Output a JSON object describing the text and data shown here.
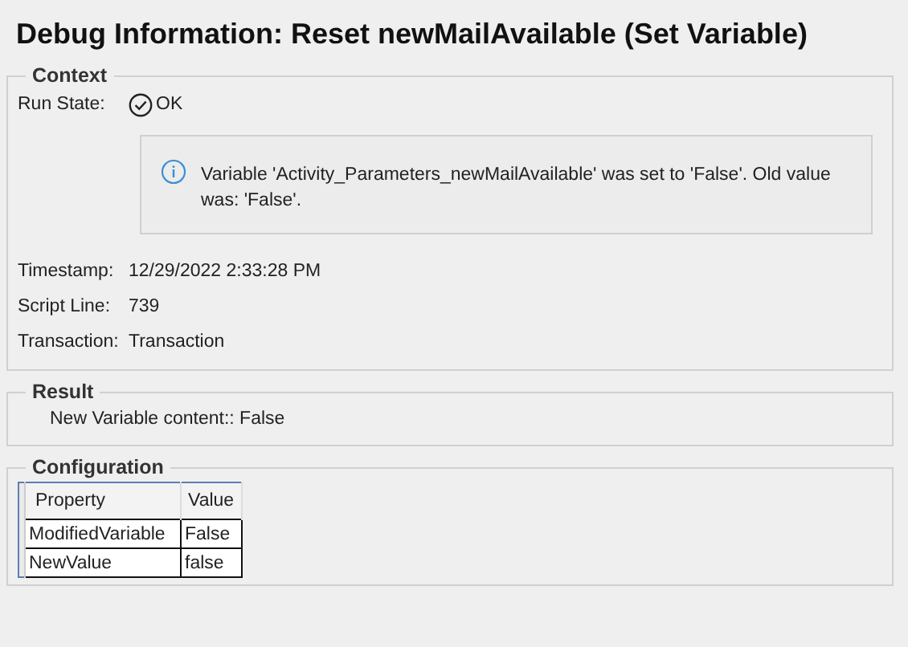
{
  "title": "Debug Information: Reset newMailAvailable (Set Variable)",
  "context": {
    "legend": "Context",
    "run_state": {
      "label": "Run State:",
      "value": "OK"
    },
    "message": "Variable 'Activity_Parameters_newMailAvailable' was set to 'False'. Old value was: 'False'.",
    "fields": [
      {
        "label": "Timestamp:",
        "value": "12/29/2022 2:33:28 PM"
      },
      {
        "label": "Script Line:",
        "value": "739"
      },
      {
        "label": "Transaction:",
        "value": "Transaction"
      }
    ]
  },
  "result": {
    "legend": "Result",
    "text": "New Variable content:: False"
  },
  "configuration": {
    "legend": "Configuration",
    "columns": [
      "Property",
      "Value"
    ],
    "rows": [
      [
        "ModifiedVariable",
        "False"
      ],
      [
        "NewValue",
        "false"
      ]
    ]
  }
}
